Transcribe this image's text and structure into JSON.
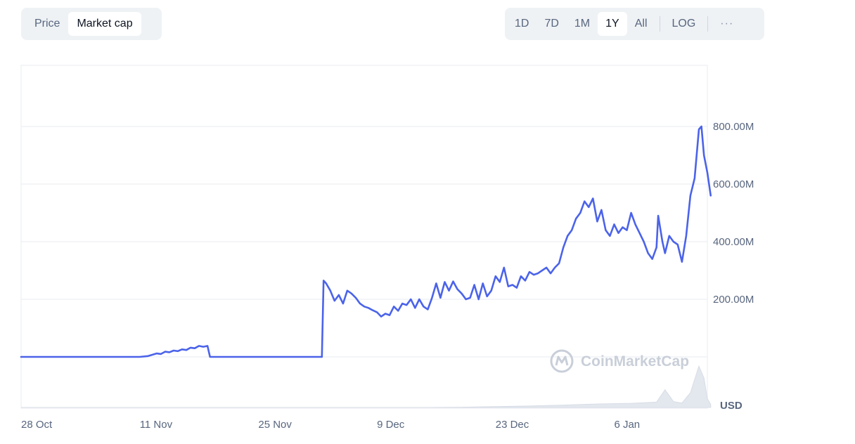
{
  "toggles": {
    "type": [
      {
        "label": "Price",
        "active": false
      },
      {
        "label": "Market cap",
        "active": true
      }
    ],
    "range": [
      {
        "label": "1D",
        "active": false
      },
      {
        "label": "7D",
        "active": false
      },
      {
        "label": "1M",
        "active": false
      },
      {
        "label": "1Y",
        "active": true
      },
      {
        "label": "All",
        "active": false
      }
    ],
    "log_label": "LOG",
    "more_label": "···"
  },
  "watermark": "CoinMarketCap",
  "chart_data": {
    "type": "line",
    "title": "",
    "xlabel": "",
    "ylabel": "",
    "unit_label": "USD",
    "line_color": "#4b63ea",
    "grid": true,
    "ylim": [
      0,
      1000000000
    ],
    "y_ticks": [
      {
        "value": 200000000,
        "label": "200.00M"
      },
      {
        "value": 400000000,
        "label": "400.00M"
      },
      {
        "value": 600000000,
        "label": "600.00M"
      },
      {
        "value": 800000000,
        "label": "800.00M"
      }
    ],
    "x_ticks": [
      "28 Oct",
      "11 Nov",
      "25 Nov",
      "9 Dec",
      "23 Dec",
      "6 Jan"
    ],
    "x_tick_days": [
      0,
      14,
      28,
      42,
      56,
      70
    ],
    "x_range_days": [
      0,
      81
    ],
    "series": [
      {
        "values": [
          [
            0,
            0
          ],
          [
            7,
            0
          ],
          [
            13,
            0
          ],
          [
            14,
            0
          ],
          [
            15,
            3000000
          ],
          [
            16,
            12000000
          ],
          [
            16.5,
            10000000
          ],
          [
            17,
            18000000
          ],
          [
            17.5,
            16000000
          ],
          [
            18,
            22000000
          ],
          [
            18.5,
            20000000
          ],
          [
            19,
            26000000
          ],
          [
            19.5,
            24000000
          ],
          [
            20,
            32000000
          ],
          [
            20.5,
            30000000
          ],
          [
            21,
            38000000
          ],
          [
            21.5,
            35000000
          ],
          [
            22,
            38000000
          ],
          [
            22.3,
            0
          ],
          [
            30,
            0
          ],
          [
            32,
            0
          ],
          [
            34,
            0
          ],
          [
            35.5,
            0
          ],
          [
            35.7,
            265000000
          ],
          [
            36,
            255000000
          ],
          [
            36.5,
            230000000
          ],
          [
            37,
            195000000
          ],
          [
            37.5,
            215000000
          ],
          [
            38,
            185000000
          ],
          [
            38.5,
            230000000
          ],
          [
            39,
            220000000
          ],
          [
            39.5,
            205000000
          ],
          [
            40,
            185000000
          ],
          [
            40.5,
            175000000
          ],
          [
            41,
            170000000
          ],
          [
            41.5,
            162000000
          ],
          [
            42,
            155000000
          ],
          [
            42.5,
            140000000
          ],
          [
            43,
            150000000
          ],
          [
            43.5,
            145000000
          ],
          [
            44,
            175000000
          ],
          [
            44.5,
            160000000
          ],
          [
            45,
            185000000
          ],
          [
            45.5,
            180000000
          ],
          [
            46,
            200000000
          ],
          [
            46.5,
            170000000
          ],
          [
            47,
            200000000
          ],
          [
            47.5,
            175000000
          ],
          [
            48,
            165000000
          ],
          [
            48.5,
            205000000
          ],
          [
            49,
            255000000
          ],
          [
            49.5,
            205000000
          ],
          [
            50,
            260000000
          ],
          [
            50.5,
            230000000
          ],
          [
            51,
            262000000
          ],
          [
            51.5,
            235000000
          ],
          [
            52,
            220000000
          ],
          [
            52.5,
            200000000
          ],
          [
            53,
            205000000
          ],
          [
            53.5,
            250000000
          ],
          [
            54,
            200000000
          ],
          [
            54.5,
            255000000
          ],
          [
            55,
            210000000
          ],
          [
            55.5,
            230000000
          ],
          [
            56,
            280000000
          ],
          [
            56.5,
            260000000
          ],
          [
            57,
            310000000
          ],
          [
            57.5,
            245000000
          ],
          [
            58,
            250000000
          ],
          [
            58.5,
            240000000
          ],
          [
            59,
            280000000
          ],
          [
            59.5,
            265000000
          ],
          [
            60,
            295000000
          ],
          [
            60.5,
            285000000
          ],
          [
            61,
            290000000
          ],
          [
            61.5,
            300000000
          ],
          [
            62,
            310000000
          ],
          [
            62.5,
            290000000
          ],
          [
            63,
            310000000
          ],
          [
            63.5,
            325000000
          ],
          [
            64,
            380000000
          ],
          [
            64.5,
            420000000
          ],
          [
            65,
            440000000
          ],
          [
            65.5,
            480000000
          ],
          [
            66,
            500000000
          ],
          [
            66.5,
            540000000
          ],
          [
            67,
            520000000
          ],
          [
            67.5,
            550000000
          ],
          [
            68,
            470000000
          ],
          [
            68.5,
            510000000
          ],
          [
            69,
            440000000
          ],
          [
            69.5,
            420000000
          ],
          [
            70,
            460000000
          ],
          [
            70.5,
            430000000
          ],
          [
            71,
            450000000
          ],
          [
            71.5,
            440000000
          ],
          [
            72,
            500000000
          ],
          [
            72.5,
            460000000
          ],
          [
            73,
            430000000
          ],
          [
            73.5,
            400000000
          ],
          [
            74,
            360000000
          ],
          [
            74.5,
            340000000
          ],
          [
            75,
            380000000
          ],
          [
            75.2,
            490000000
          ],
          [
            75.7,
            400000000
          ],
          [
            76,
            360000000
          ],
          [
            76.5,
            420000000
          ],
          [
            77,
            400000000
          ],
          [
            77.5,
            390000000
          ],
          [
            78,
            330000000
          ],
          [
            78.5,
            420000000
          ],
          [
            79,
            560000000
          ],
          [
            79.5,
            620000000
          ],
          [
            80,
            790000000
          ],
          [
            80.3,
            800000000
          ],
          [
            80.6,
            700000000
          ],
          [
            81,
            640000000
          ],
          [
            81.4,
            560000000
          ]
        ]
      }
    ],
    "volume_series": [
      [
        0,
        0
      ],
      [
        48,
        0
      ],
      [
        52,
        1000000
      ],
      [
        56,
        3000000
      ],
      [
        60,
        5000000
      ],
      [
        64,
        8000000
      ],
      [
        68,
        12000000
      ],
      [
        72,
        14000000
      ],
      [
        75,
        18000000
      ],
      [
        76,
        60000000
      ],
      [
        77,
        20000000
      ],
      [
        78,
        15000000
      ],
      [
        79,
        50000000
      ],
      [
        80,
        140000000
      ],
      [
        80.6,
        100000000
      ],
      [
        81,
        30000000
      ],
      [
        81.4,
        10000000
      ]
    ]
  }
}
